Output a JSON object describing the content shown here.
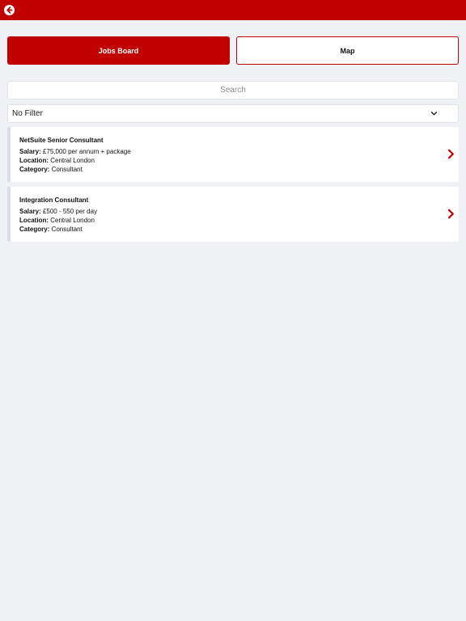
{
  "header": {
    "back_icon": "arrow-left-circle-icon",
    "accent_color": "#c10000"
  },
  "tabs": [
    {
      "label": "Jobs Board",
      "active": true
    },
    {
      "label": "Map",
      "active": false
    }
  ],
  "search": {
    "placeholder": "Search",
    "value": ""
  },
  "filter": {
    "selected": "No Filter",
    "icon": "chevron-down-icon"
  },
  "jobs": [
    {
      "title": "NetSuite Senior Consultant",
      "salary_label": "Salary:",
      "salary": "£75,000 per annum + package",
      "location_label": "Location:",
      "location": "Central London",
      "category_label": "Category:",
      "category": "Consultant",
      "icon": "chevron-right-icon"
    },
    {
      "title": "Integration Consultant",
      "salary_label": "Salary:",
      "salary": "£500 - 550 per day",
      "location_label": "Location:",
      "location": "Central London",
      "category_label": "Category:",
      "category": "Consultant",
      "icon": "chevron-right-icon"
    }
  ]
}
